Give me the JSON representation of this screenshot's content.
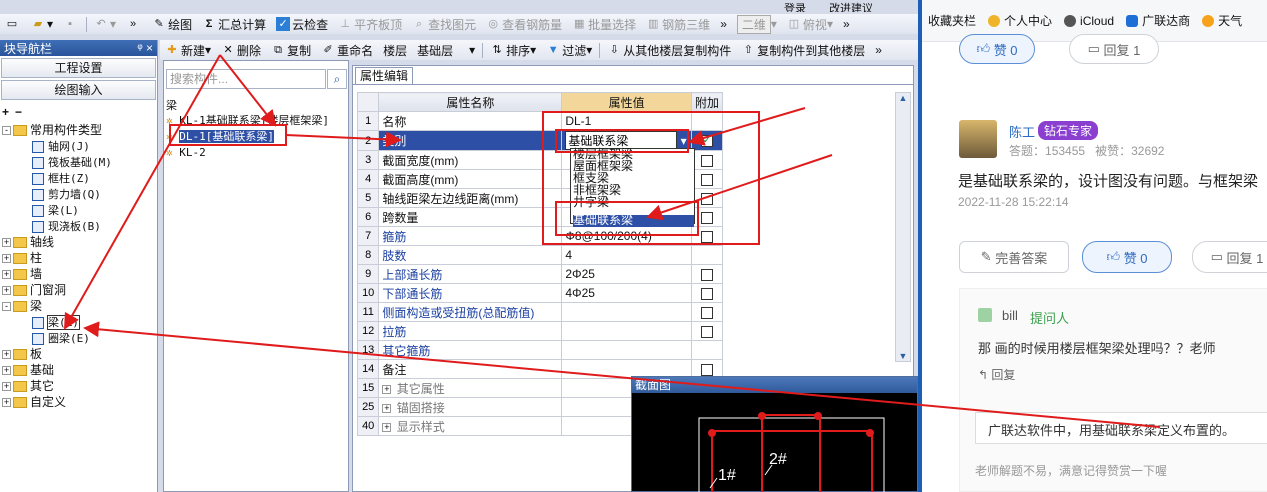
{
  "toolbar1": {
    "draw": "绘图",
    "sum": "汇总计算",
    "cloud_check": "云检查",
    "flat_plate": "平齐板顶",
    "find_elem": "查找图元",
    "view_rebar": "查看钢筋量",
    "batch_select": "批量选择",
    "rebar_3d": "钢筋三维",
    "view_2d": "二维",
    "view_top": "俯视",
    "login": "登录",
    "feedback": "改进建议"
  },
  "nav": {
    "title": "块导航栏",
    "pin": "ᵠ",
    "close": "×",
    "btn_project": "工程设置",
    "btn_draw": "绘图输入",
    "tree": [
      {
        "label": "常用构件类型",
        "level": 0,
        "kind": "folder",
        "expand": "-"
      },
      {
        "label": "轴网(J)",
        "level": 1,
        "kind": "item"
      },
      {
        "label": "筏板基础(M)",
        "level": 1,
        "kind": "item"
      },
      {
        "label": "框柱(Z)",
        "level": 1,
        "kind": "item"
      },
      {
        "label": "剪力墙(Q)",
        "level": 1,
        "kind": "item"
      },
      {
        "label": "梁(L)",
        "level": 1,
        "kind": "item"
      },
      {
        "label": "现浇板(B)",
        "level": 1,
        "kind": "item"
      },
      {
        "label": "轴线",
        "level": 0,
        "kind": "folder",
        "expand": "+"
      },
      {
        "label": "柱",
        "level": 0,
        "kind": "folder",
        "expand": "+"
      },
      {
        "label": "墙",
        "level": 0,
        "kind": "folder",
        "expand": "+"
      },
      {
        "label": "门窗洞",
        "level": 0,
        "kind": "folder",
        "expand": "+"
      },
      {
        "label": "梁",
        "level": 0,
        "kind": "folder",
        "expand": "-"
      },
      {
        "label": "梁(L)",
        "level": 1,
        "kind": "item",
        "boxed": true
      },
      {
        "label": "圈梁(E)",
        "level": 1,
        "kind": "item"
      },
      {
        "label": "板",
        "level": 0,
        "kind": "folder",
        "expand": "+"
      },
      {
        "label": "基础",
        "level": 0,
        "kind": "folder",
        "expand": "+"
      },
      {
        "label": "其它",
        "level": 0,
        "kind": "folder",
        "expand": "+"
      },
      {
        "label": "自定义",
        "level": 0,
        "kind": "folder",
        "expand": "+"
      }
    ]
  },
  "toolbar2": {
    "new": "新建",
    "delete": "删除",
    "copy": "复制",
    "rename": "重命名",
    "floor_label": "楼层",
    "floor_value": "基础层",
    "sort": "排序",
    "filter": "过滤",
    "copy_from": "从其他楼层复制构件",
    "copy_to": "复制构件到其他楼层"
  },
  "list": {
    "search_placeholder": "搜索构件...",
    "group": "梁",
    "items": [
      "KL-1基础联系梁[楼层框架梁]",
      "DL-1[基础联系梁]",
      "KL-2"
    ]
  },
  "props": {
    "tab": "属性编辑",
    "col_name": "属性名称",
    "col_value": "属性值",
    "col_add": "附加",
    "rows": [
      {
        "n": "1",
        "name": "名称",
        "value": "DL-1",
        "blue": false,
        "chk": false
      },
      {
        "n": "2",
        "name": "类别",
        "value": "基础联系梁",
        "blue": false,
        "chk": true,
        "selected": true
      },
      {
        "n": "3",
        "name": "截面宽度(mm)",
        "value": "",
        "blue": false,
        "chk": true
      },
      {
        "n": "4",
        "name": "截面高度(mm)",
        "value": "",
        "blue": false,
        "chk": true
      },
      {
        "n": "5",
        "name": "轴线距梁左边线距离(mm)",
        "value": "",
        "blue": false,
        "chk": true
      },
      {
        "n": "6",
        "name": "跨数量",
        "value": "",
        "blue": false,
        "chk": true
      },
      {
        "n": "7",
        "name": "箍筋",
        "value": "Φ8@100/200(4)",
        "blue": true,
        "chk": true
      },
      {
        "n": "8",
        "name": "肢数",
        "value": "4",
        "blue": true,
        "chk": false
      },
      {
        "n": "9",
        "name": "上部通长筋",
        "value": "2Φ25",
        "blue": true,
        "chk": true
      },
      {
        "n": "10",
        "name": "下部通长筋",
        "value": "4Φ25",
        "blue": true,
        "chk": true
      },
      {
        "n": "11",
        "name": "侧面构造或受扭筋(总配筋值)",
        "value": "",
        "blue": true,
        "chk": true
      },
      {
        "n": "12",
        "name": "拉筋",
        "value": "",
        "blue": true,
        "chk": true
      },
      {
        "n": "13",
        "name": "其它箍筋",
        "value": "",
        "blue": true,
        "chk": false
      },
      {
        "n": "14",
        "name": "备注",
        "value": "",
        "blue": false,
        "chk": true
      },
      {
        "n": "15",
        "name": "其它属性",
        "value": "",
        "blue": false,
        "chk": false,
        "group": true
      },
      {
        "n": "25",
        "name": "锚固搭接",
        "value": "",
        "blue": false,
        "chk": false,
        "group": true
      },
      {
        "n": "40",
        "name": "显示样式",
        "value": "",
        "blue": false,
        "chk": false,
        "group": true
      }
    ],
    "dropdown": [
      "楼层框架梁",
      "屋面框架梁",
      "框支梁",
      "非框架梁",
      "井字梁",
      "基础联系梁"
    ],
    "dropdown_selected": 5
  },
  "popup": {
    "title": "截面图",
    "label1": "1#",
    "label2": "2#"
  },
  "browser": {
    "bookmarks": [
      "收藏夹栏",
      "个人中心",
      "iCloud",
      "广联达商",
      "天气"
    ],
    "likes_top": "赞 0",
    "reply_top": "回复 1",
    "user": "陈工",
    "badge": "钻石专家",
    "answers_label": "答题：",
    "answers": "153455",
    "adopted_label": "被赞：",
    "adopted": "32692",
    "answer_text": "是基础联系梁的，设计图没有问题。与框架梁",
    "date": "2022-11-28 15:22:14",
    "perfect": "完善答案",
    "likes": "赞 0",
    "reply": "回复 1",
    "asker": "bill",
    "asker_tag": "提问人",
    "question": "那 画的时候用楼层框架梁处理吗？？老师",
    "reply_link": "回复",
    "comment": "广联达软件中，用基础联系梁定义布置的。",
    "footer": "老师解题不易，满意记得赞赏一下喔"
  },
  "colors": {
    "arrow": "#e01b1b",
    "accent": "#2d6bc4",
    "badge": "#8a3fd0",
    "select": "#2d4fa6"
  }
}
